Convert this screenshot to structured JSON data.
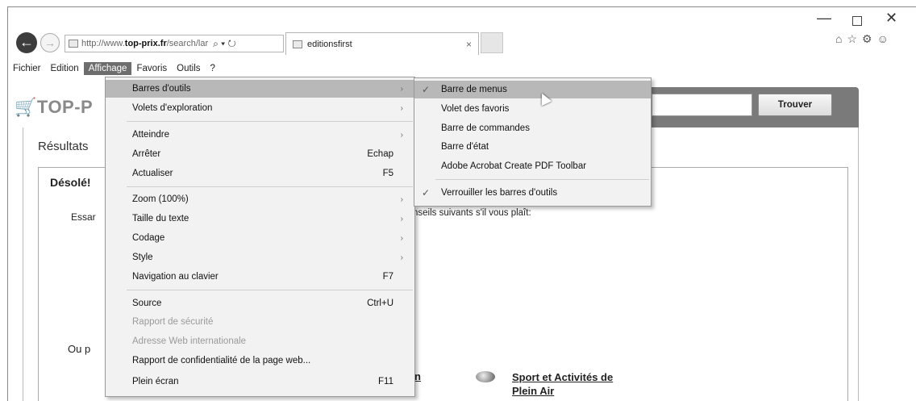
{
  "window": {
    "minimize_glyph": "—",
    "maximize_glyph": "",
    "close_glyph": "✕"
  },
  "nav": {
    "url_prefix": "http://www.",
    "url_domain": "top-prix.fr",
    "url_suffix": "/search/lar",
    "address_tools": "⌕ ▾ ↻",
    "tab_title": "editionsfirst",
    "tab_close": "×",
    "toolbar_icons": [
      "home-icon",
      "star-icon",
      "gear-icon",
      "smiley-icon"
    ]
  },
  "menubar": {
    "items": [
      "Fichier",
      "Edition",
      "Affichage",
      "Favoris",
      "Outils",
      "?"
    ],
    "active": "Affichage"
  },
  "page": {
    "logo": "TOP-P",
    "search_button": "Trouver",
    "results_title": "Résultats",
    "sorry_title": "Désolé!",
    "essay_text": "Essar",
    "advice_text": "nseils suivants s'il vous plaît:",
    "ou_text": "Ou p",
    "category_fragment": "n",
    "category_line1": "Sport et Activités de",
    "category_line2": "Plein Air"
  },
  "affichage_menu": {
    "items": [
      {
        "label": "Barres d'outils",
        "arrow": "›",
        "hover": true
      },
      {
        "label": "Volets d'exploration",
        "arrow": "›"
      },
      {
        "label": "Atteindre",
        "arrow": "›"
      },
      {
        "label": "Arrêter",
        "shortcut": "Echap"
      },
      {
        "label": "Actualiser",
        "shortcut": "F5"
      },
      {
        "label": "Zoom (100%)",
        "arrow": "›"
      },
      {
        "label": "Taille du texte",
        "arrow": "›"
      },
      {
        "label": "Codage",
        "arrow": "›"
      },
      {
        "label": "Style",
        "arrow": "›"
      },
      {
        "label": "Navigation au clavier",
        "shortcut": "F7"
      },
      {
        "label": "Source",
        "shortcut": "Ctrl+U"
      },
      {
        "label": "Rapport de sécurité",
        "disabled": true
      },
      {
        "label": "Adresse Web internationale",
        "disabled": true
      },
      {
        "label": "Rapport de confidentialité de la page web..."
      },
      {
        "label": "Plein écran",
        "shortcut": "F11"
      }
    ]
  },
  "toolbars_submenu": {
    "items": [
      {
        "label": "Barre de menus",
        "checked": true,
        "hover": true
      },
      {
        "label": "Volet des favoris"
      },
      {
        "label": "Barre de commandes"
      },
      {
        "label": "Barre d'état"
      },
      {
        "label": "Adobe Acrobat Create PDF Toolbar"
      },
      {
        "label": "Verrouiller les barres d'outils",
        "checked": true
      }
    ],
    "check_glyph": "✓"
  },
  "colors": {
    "menu_bg": "#f2f2f2",
    "menu_hover": "#b8b8b8",
    "active_menubar": "#6d6d6d",
    "header_band": "#7a7a7a"
  }
}
